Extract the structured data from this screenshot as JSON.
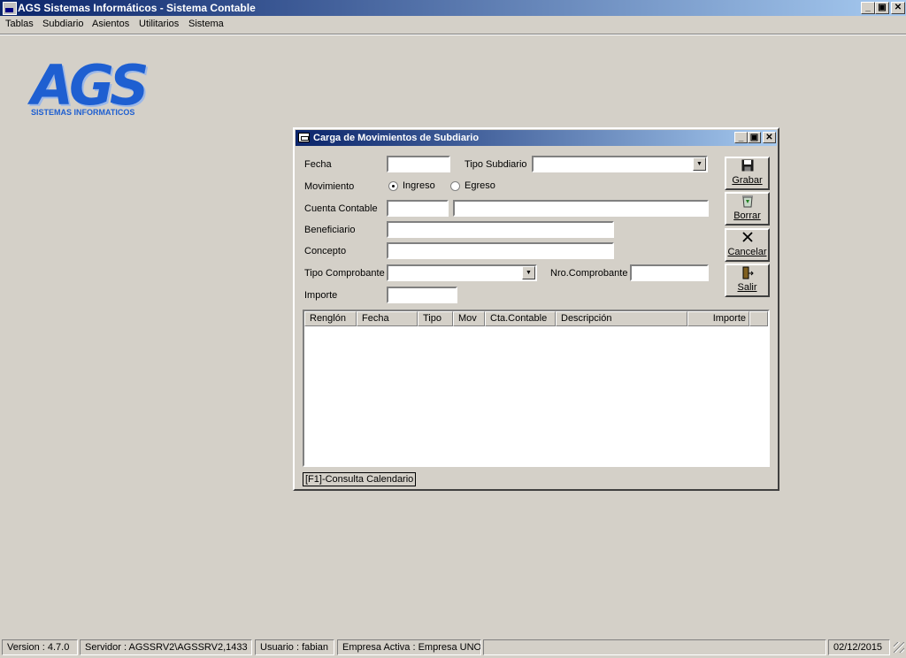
{
  "app": {
    "title": "AGS Sistemas Informáticos - Sistema Contable",
    "caption_buttons": {
      "minimize": "_",
      "restore": "▣",
      "close": "✕"
    }
  },
  "menu": [
    "Tablas",
    "Subdiario",
    "Asientos",
    "Utilitarios",
    "Sistema"
  ],
  "logo": {
    "big": "AGS",
    "small": "SISTEMAS INFORMATICOS"
  },
  "dialog": {
    "title": "Carga de Movimientos de Subdiario",
    "fields": {
      "fecha_label": "Fecha",
      "fecha_value": "",
      "tipo_subdiario_label": "Tipo Subdiario",
      "tipo_subdiario_value": "",
      "movimiento_label": "Movimiento",
      "ingreso_label": "Ingreso",
      "egreso_label": "Egreso",
      "movimiento_selected": "Ingreso",
      "cuenta_label": "Cuenta Contable",
      "cuenta_code_value": "",
      "cuenta_desc_value": "",
      "beneficiario_label": "Beneficiario",
      "beneficiario_value": "",
      "concepto_label": "Concepto",
      "concepto_value": "",
      "tipo_comprobante_label": "Tipo Comprobante",
      "tipo_comprobante_value": "",
      "nro_comprobante_label": "Nro.Comprobante",
      "nro_comprobante_value": "",
      "importe_label": "Importe",
      "importe_value": ""
    },
    "buttons": [
      {
        "label": "Grabar",
        "icon": "floppy-disk-icon"
      },
      {
        "label": "Borrar",
        "icon": "recycle-bin-icon"
      },
      {
        "label": "Cancelar",
        "icon": "x-mark-icon"
      },
      {
        "label": "Salir",
        "icon": "exit-door-icon"
      }
    ],
    "grid_columns": [
      "Renglón",
      "Fecha",
      "Tipo",
      "Mov",
      "Cta.Contable",
      "Descripción",
      "Importe"
    ],
    "grid_rows": [],
    "hint": "[F1]-Consulta Calendario"
  },
  "status": {
    "version": "Version : 4.7.0",
    "servidor": "Servidor : AGSSRV2\\AGSSRV2,1433",
    "usuario": "Usuario : fabian",
    "empresa": "Empresa Activa : Empresa UNO",
    "empty": "",
    "date": "02/12/2015"
  },
  "colors": {
    "titlebar_start": "#0a246a",
    "titlebar_end": "#a6caf0",
    "logo": "#1e5fd1",
    "face": "#d4d0c8"
  }
}
